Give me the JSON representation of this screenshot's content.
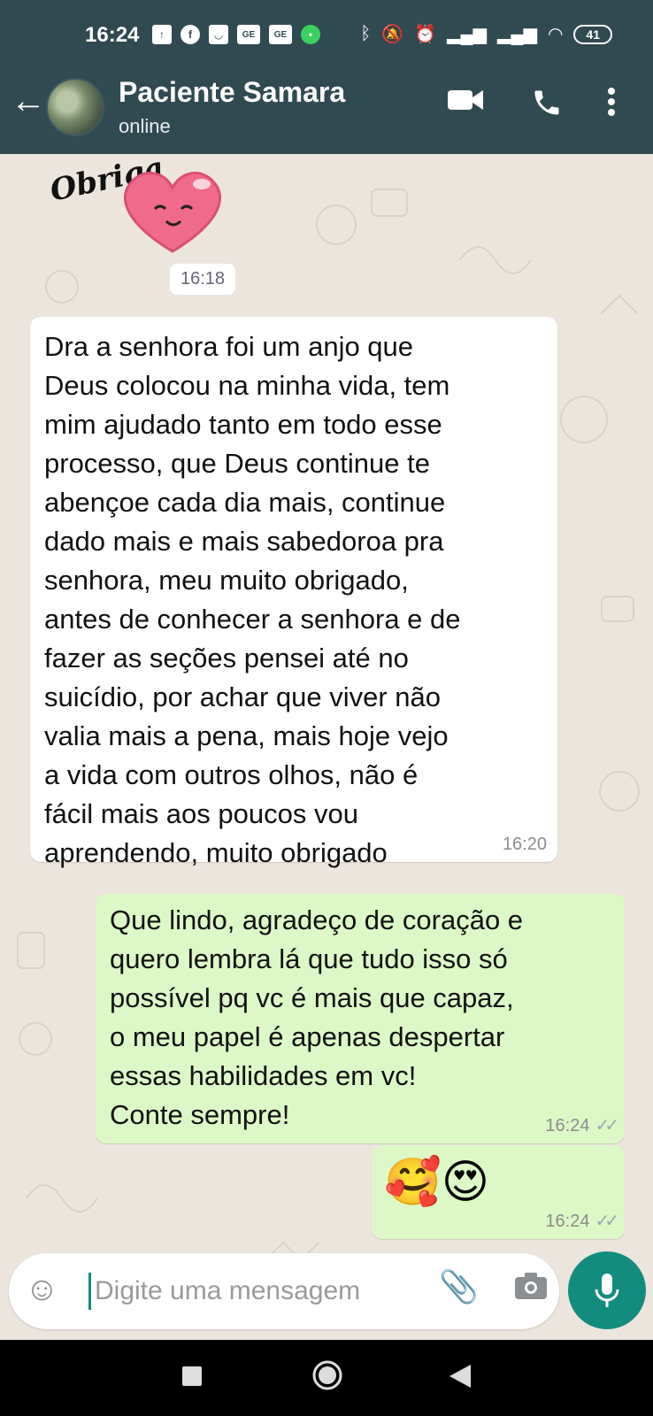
{
  "status_bar": {
    "time": "16:24",
    "left_icons": [
      "upload-icon",
      "facebook-icon",
      "app-icon",
      "ge-icon",
      "ge-icon",
      "chat-icon"
    ],
    "right_icons": [
      "bluetooth-icon",
      "mute-icon",
      "alarm-icon",
      "signal-icon",
      "signal-icon",
      "wifi-icon"
    ],
    "battery": "41"
  },
  "header": {
    "contact_name": "Paciente Samara",
    "status": "online"
  },
  "messages": [
    {
      "type": "sticker",
      "time": "16:18"
    },
    {
      "type": "incoming",
      "text": "Dra a senhora foi um anjo que\nDeus colocou na minha vida, tem\nmim ajudado tanto em todo esse\nprocesso, que Deus continue te\nabençoe cada dia mais, continue\ndado mais e mais sabedoroa pra\nsenhora, meu muito obrigado,\nantes de conhecer a senhora e de\nfazer as seções pensei até no\nsuicídio, por achar que viver não\nvalia mais a pena, mais hoje vejo\na vida com outros olhos, não é\nfácil mais aos poucos vou\naprendendo, muito obrigado",
      "time": "16:20"
    },
    {
      "type": "outgoing",
      "text": "Que lindo, agradeço de coração e\nquero lembra lá que tudo isso só\npossível pq vc é mais que  capaz,\no meu papel é apenas despertar\nessas habilidades em vc!\nConte sempre!",
      "time": "16:24"
    },
    {
      "type": "outgoing",
      "text": "🥰😍",
      "time": "16:24"
    }
  ],
  "composer": {
    "placeholder": "Digite uma mensagem"
  },
  "colors": {
    "header": "#304a52",
    "outgoing_bubble": "#dcf8c6",
    "incoming_bubble": "#ffffff",
    "accent": "#128c7e",
    "chat_background": "#ece5dd"
  }
}
